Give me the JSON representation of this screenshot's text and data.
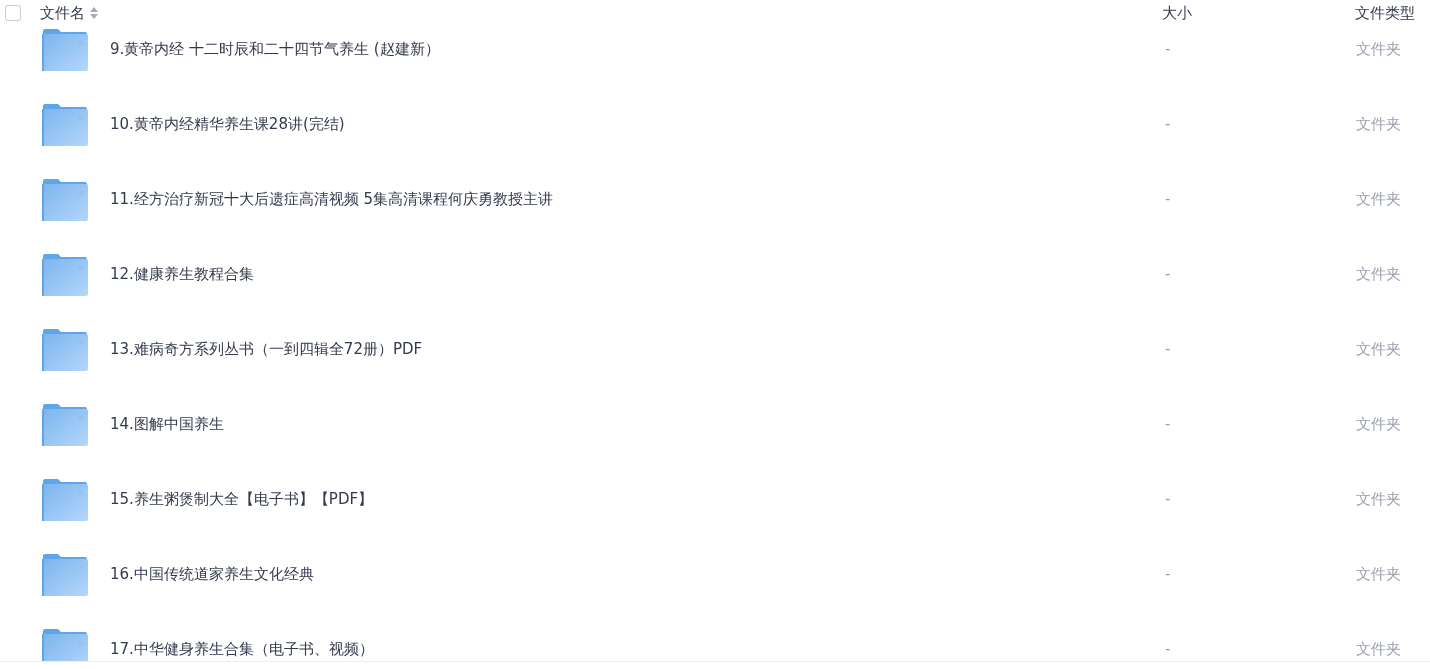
{
  "header": {
    "select_all": {
      "checked": false
    },
    "columns": [
      {
        "label": "文件名",
        "sortable": true
      },
      {
        "label": "大小",
        "sortable": false
      },
      {
        "label": "文件类型",
        "sortable": false
      }
    ]
  },
  "rows": [
    {
      "name": "9.黄帝内经 十二时辰和二十四节气养生 (赵建新）",
      "size": "-",
      "type": "文件夹",
      "kind": "folder"
    },
    {
      "name": "10.黄帝内经精华养生课28讲(完结)",
      "size": "-",
      "type": "文件夹",
      "kind": "folder"
    },
    {
      "name": "11.经方治疗新冠十大后遗症高清视频 5集高清课程何庆勇教授主讲",
      "size": "-",
      "type": "文件夹",
      "kind": "folder"
    },
    {
      "name": "12.健康养生教程合集",
      "size": "-",
      "type": "文件夹",
      "kind": "folder"
    },
    {
      "name": "13.难病奇方系列丛书（一到四辑全72册）PDF",
      "size": "-",
      "type": "文件夹",
      "kind": "folder"
    },
    {
      "name": "14.图解中国养生",
      "size": "-",
      "type": "文件夹",
      "kind": "folder"
    },
    {
      "name": "15.养生粥煲制大全【电子书】【PDF】",
      "size": "-",
      "type": "文件夹",
      "kind": "folder"
    },
    {
      "name": "16.中国传统道家养生文化经典",
      "size": "-",
      "type": "文件夹",
      "kind": "folder"
    },
    {
      "name": "17.中华健身养生合集（电子书、视频）",
      "size": "-",
      "type": "文件夹",
      "kind": "folder"
    }
  ]
}
